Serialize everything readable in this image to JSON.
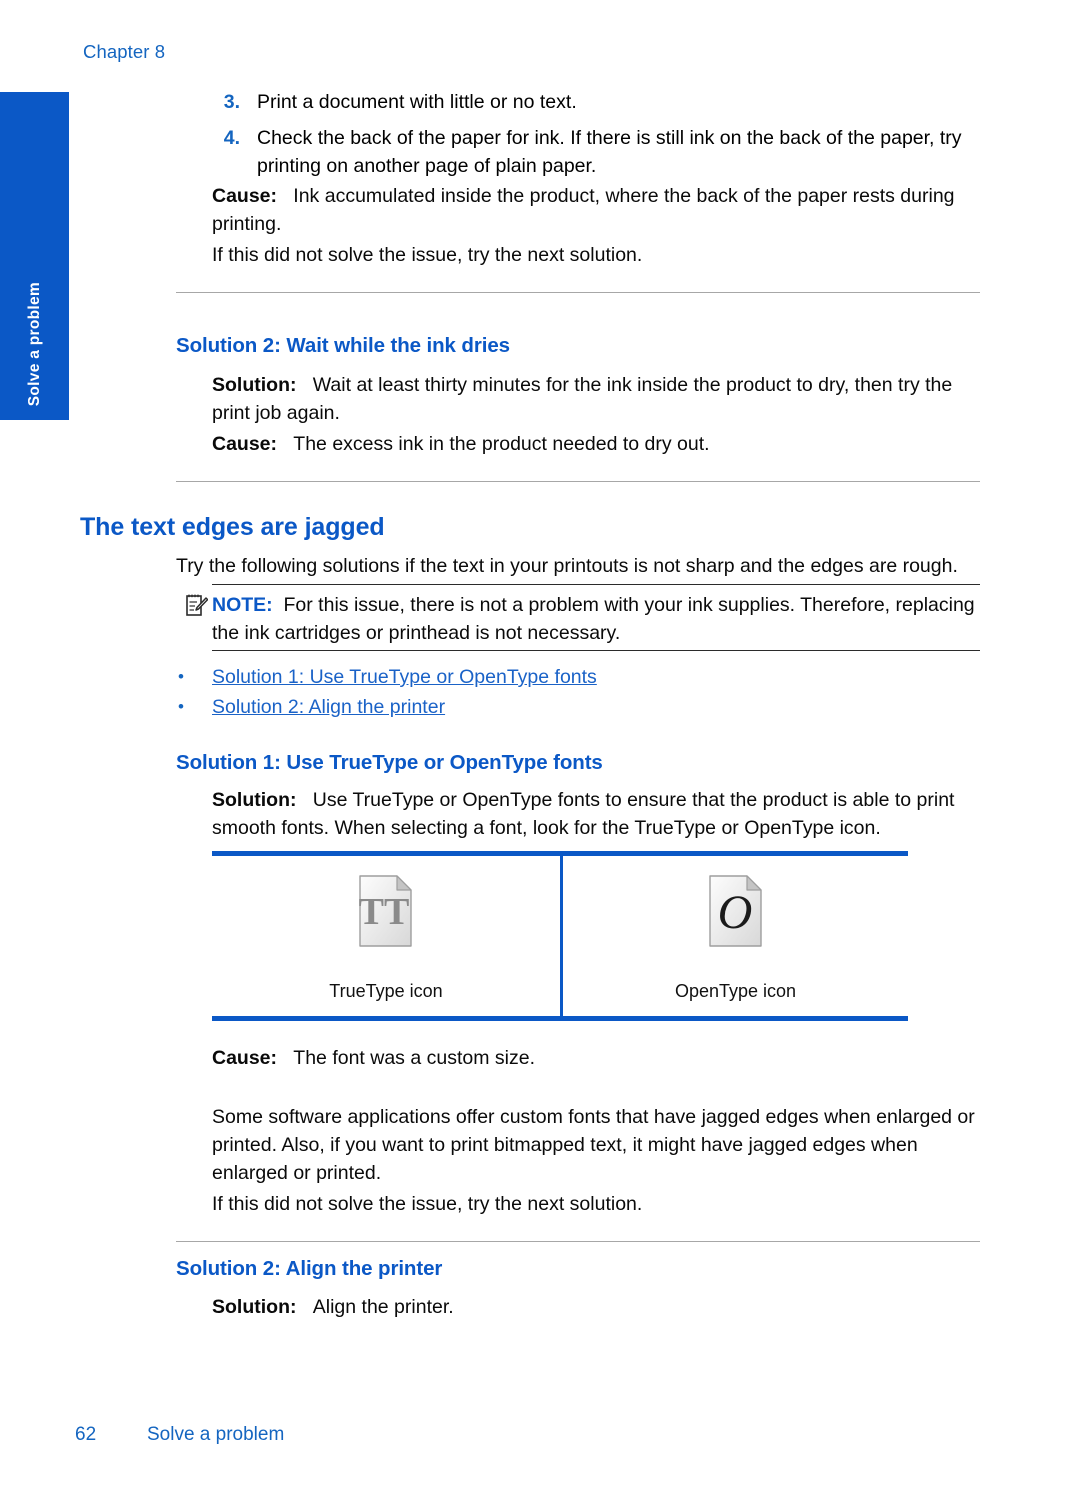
{
  "page": {
    "chapter_label": "Chapter 8",
    "side_tab_label": "Solve a problem",
    "footer_page_number": "62",
    "footer_section": "Solve a problem",
    "accent_blue": "#0b58c6",
    "link_blue": "#1a62c7",
    "heading_blue": "#0b58c6"
  },
  "numbered_steps": [
    {
      "num": "3.",
      "text": "Print a document with little or no text."
    },
    {
      "num": "4.",
      "text": "Check the back of the paper for ink. If there is still ink on the back of the paper, try printing on another page of plain paper."
    }
  ],
  "cause_block_1": {
    "label": "Cause:",
    "text": "Ink accumulated inside the product, where the back of the paper rests during printing."
  },
  "retry_line_1": "If this did not solve the issue, try the next solution.",
  "solution_2_ink_dries": {
    "heading": "Solution 2: Wait while the ink dries",
    "solution_label": "Solution:",
    "solution_text": "Wait at least thirty minutes for the ink inside the product to dry, then try the print job again.",
    "cause_label": "Cause:",
    "cause_text": "The excess ink in the product needed to dry out."
  },
  "text_edges_section": {
    "heading": "The text edges are jagged",
    "intro": "Try the following solutions if the text in your printouts is not sharp and the edges are rough.",
    "note": {
      "icon": "note-pencil-icon",
      "label": "NOTE:",
      "text": "For this issue, there is not a problem with your ink supplies. Therefore, replacing the ink cartridges or printhead is not necessary."
    },
    "links": [
      "Solution 1: Use TrueType or OpenType fonts",
      "Solution 2: Align the printer"
    ]
  },
  "solution_1_fonts": {
    "heading": "Solution 1: Use TrueType or OpenType fonts",
    "solution_label": "Solution:",
    "solution_text": "Use TrueType or OpenType fonts to ensure that the product is able to print smooth fonts. When selecting a font, look for the TrueType or OpenType icon.",
    "table": {
      "cells": [
        {
          "icon": "truetype-font-file-icon",
          "glyph": "TT",
          "caption": "TrueType icon"
        },
        {
          "icon": "opentype-font-file-icon",
          "glyph": "O",
          "caption": "OpenType icon"
        }
      ]
    },
    "cause_label": "Cause:",
    "cause_text": "The font was a custom size.",
    "body_paragraph": "Some software applications offer custom fonts that have jagged edges when enlarged or printed. Also, if you want to print bitmapped text, it might have jagged edges when enlarged or printed.",
    "retry_line": "If this did not solve the issue, try the next solution."
  },
  "solution_2_align": {
    "heading": "Solution 2: Align the printer",
    "solution_label": "Solution:",
    "solution_text": "Align the printer."
  }
}
